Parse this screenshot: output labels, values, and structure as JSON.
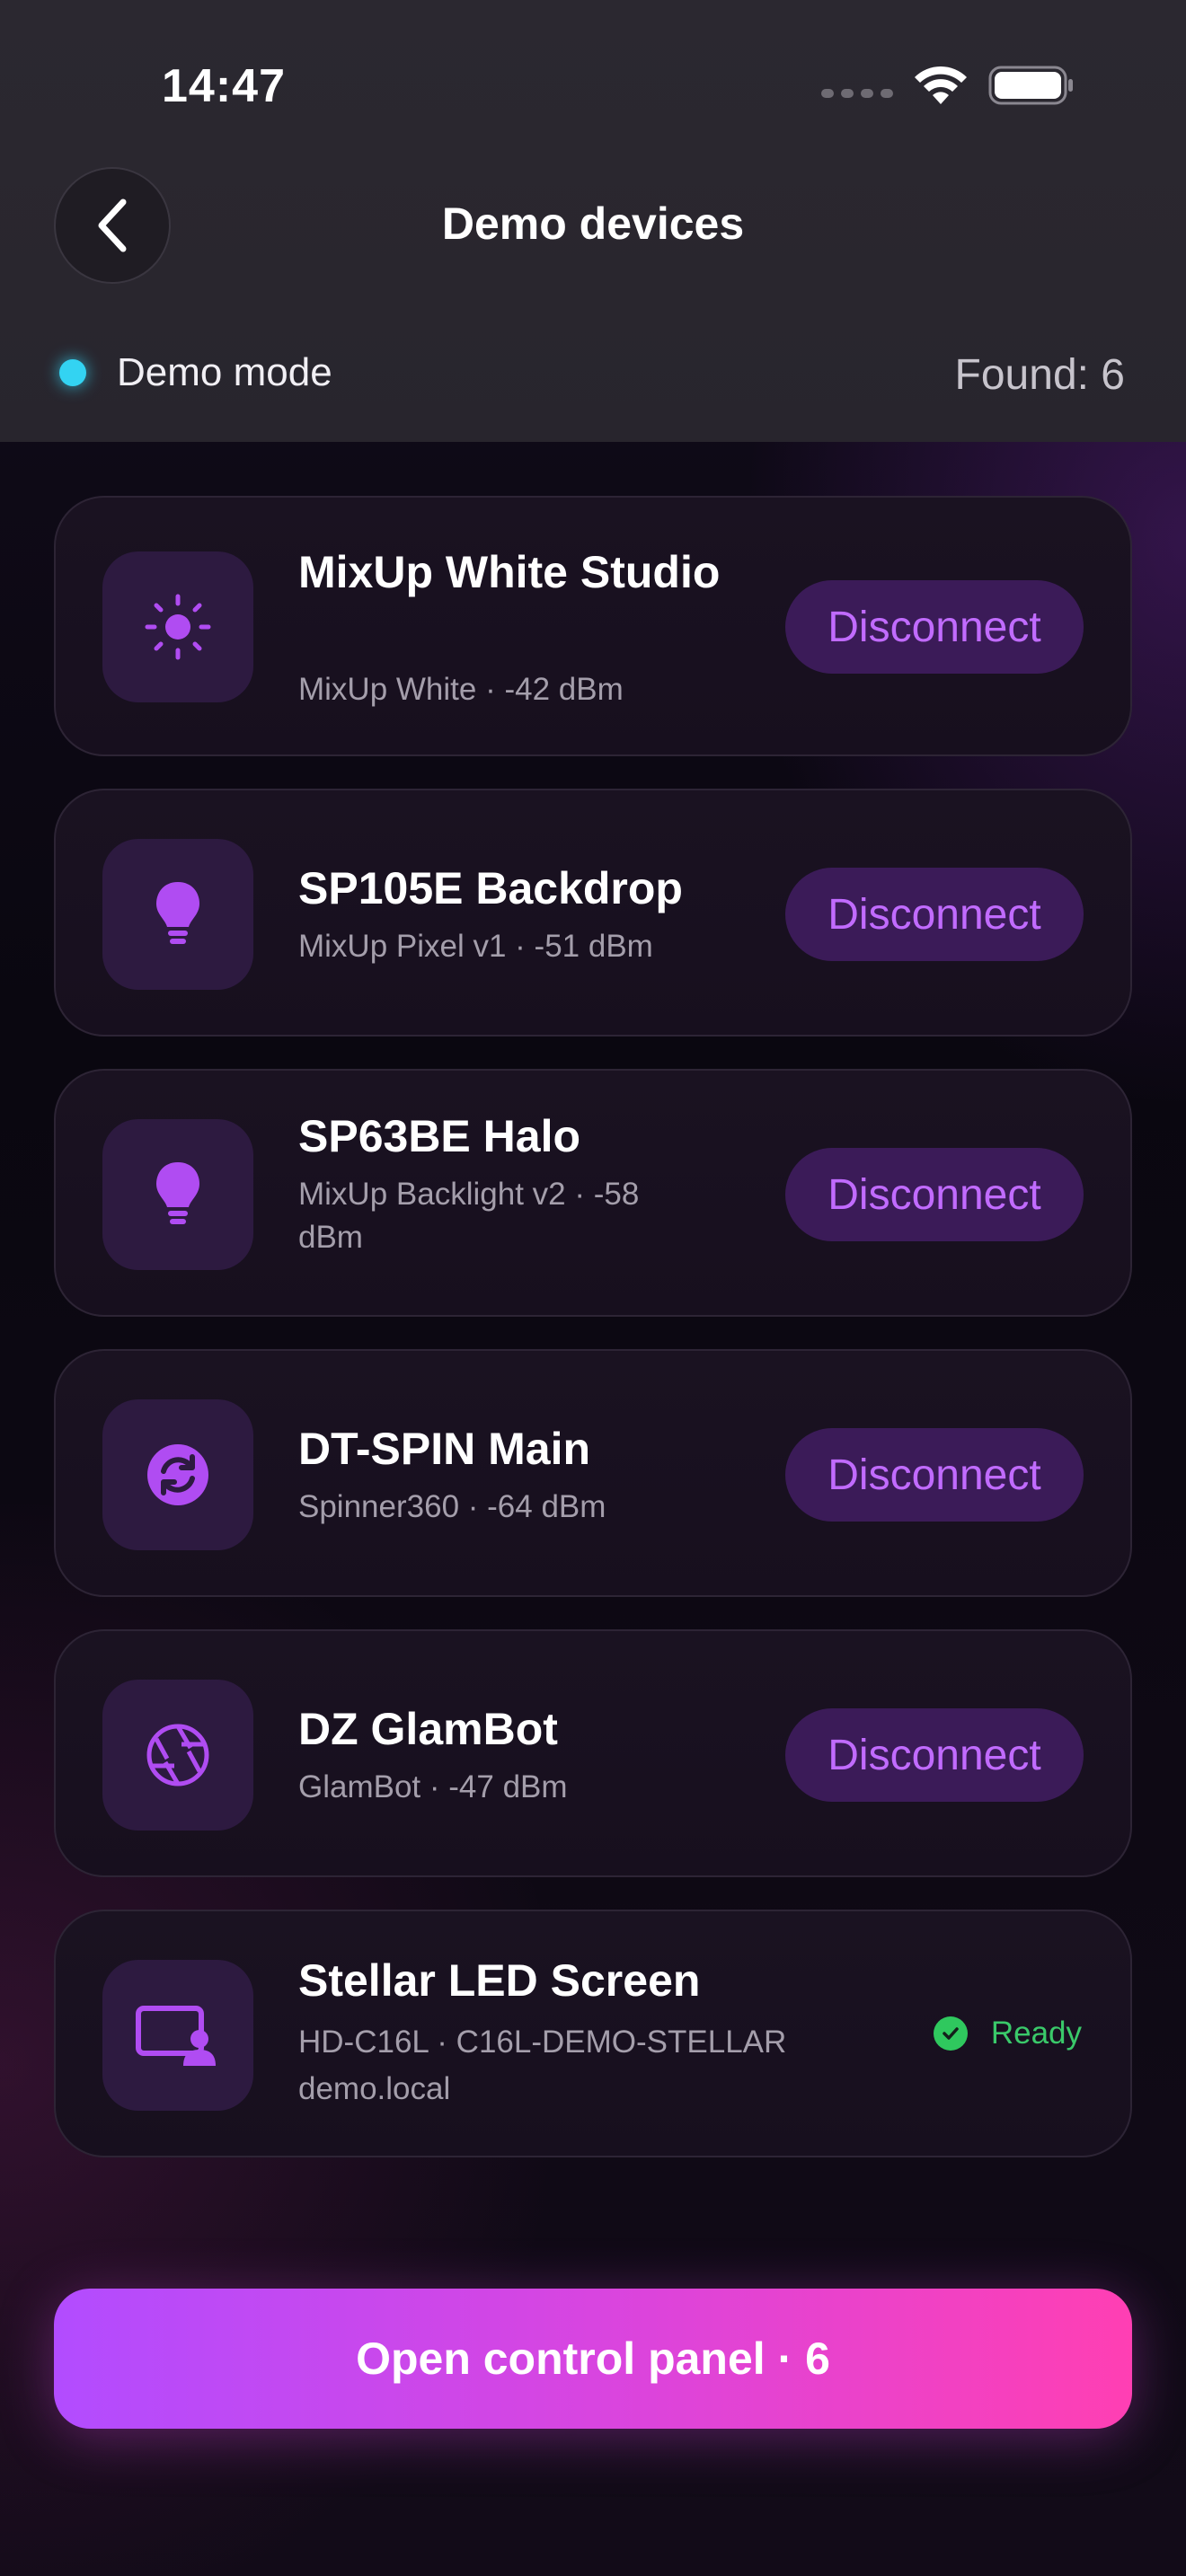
{
  "status_bar": {
    "time": "14:47"
  },
  "header": {
    "title": "Demo devices",
    "mode_label": "Demo mode",
    "found": "Found: 6"
  },
  "devices": [
    {
      "name": "MixUp White Studio",
      "detail": "MixUp White · -42 dBm",
      "icon": "sun-icon",
      "action": "Disconnect"
    },
    {
      "name": "SP105E Backdrop",
      "detail": "MixUp Pixel v1 · -51 dBm",
      "icon": "lightbulb-icon",
      "action": "Disconnect"
    },
    {
      "name": "SP63BE Halo",
      "detail": "MixUp Backlight v2 · -58 dBm",
      "icon": "lightbulb-icon",
      "action": "Disconnect"
    },
    {
      "name": "DT-SPIN Main",
      "detail": "Spinner360 · -64 dBm",
      "icon": "rotate-icon",
      "action": "Disconnect"
    },
    {
      "name": "DZ GlamBot",
      "detail": "GlamBot · -47 dBm",
      "icon": "aperture-icon",
      "action": "Disconnect"
    },
    {
      "name": "Stellar LED Screen",
      "detail": "HD-C16L · C16L-DEMO-STELLAR",
      "detail2": "demo.local",
      "icon": "screen-user-icon",
      "status": "Ready"
    }
  ],
  "cta": {
    "label": "Open control panel · 6"
  },
  "colors": {
    "accent": "#c16bff",
    "ready": "#3ac96a",
    "mode_dot": "#33d3f2",
    "cta_start": "#b24cff",
    "cta_end": "#ff3fb3"
  }
}
